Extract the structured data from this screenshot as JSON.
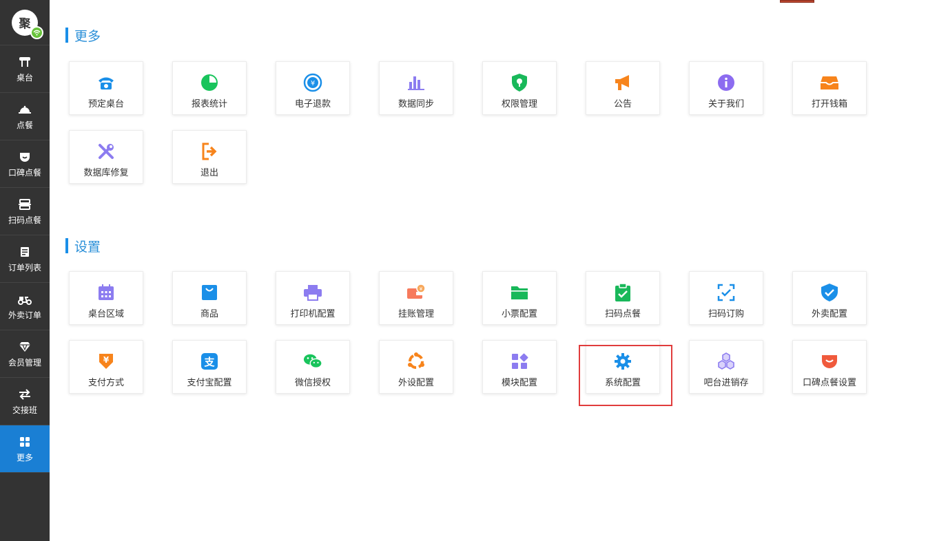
{
  "sidebar": {
    "logo_text": "聚",
    "items": [
      {
        "label": "桌台",
        "icon": "table-icon"
      },
      {
        "label": "点餐",
        "icon": "cloche-icon"
      },
      {
        "label": "口碑点餐",
        "icon": "koubei-icon"
      },
      {
        "label": "扫码点餐",
        "icon": "scan-icon"
      },
      {
        "label": "订单列表",
        "icon": "order-list-icon"
      },
      {
        "label": "外卖订单",
        "icon": "delivery-icon"
      },
      {
        "label": "会员管理",
        "icon": "diamond-icon"
      },
      {
        "label": "交接班",
        "icon": "swap-icon"
      },
      {
        "label": "更多",
        "icon": "grid-icon",
        "active": true
      }
    ]
  },
  "sections": {
    "more": {
      "title": "更多",
      "tiles": [
        {
          "label": "预定桌台",
          "icon": "phone-icon",
          "color": "#1a8fe8"
        },
        {
          "label": "报表统计",
          "icon": "pie-chart-icon",
          "color": "#19c45c"
        },
        {
          "label": "电子退款",
          "icon": "refund-icon",
          "color": "#1a8fe8"
        },
        {
          "label": "数据同步",
          "icon": "bar-chart-icon",
          "color": "#8c7cf0"
        },
        {
          "label": "权限管理",
          "icon": "shield-icon",
          "color": "#19b85a"
        },
        {
          "label": "公告",
          "icon": "megaphone-icon",
          "color": "#f7841c"
        },
        {
          "label": "关于我们",
          "icon": "info-icon",
          "color": "#8c6cf0"
        },
        {
          "label": "打开钱箱",
          "icon": "cashbox-icon",
          "color": "#f7841c"
        },
        {
          "label": "数据库修复",
          "icon": "tools-icon",
          "color": "#8c7cf0"
        },
        {
          "label": "退出",
          "icon": "exit-icon",
          "color": "#f7841c"
        }
      ]
    },
    "settings": {
      "title": "设置",
      "tiles": [
        {
          "label": "桌台区域",
          "icon": "calendar-icon",
          "color": "#8c7cf0"
        },
        {
          "label": "商品",
          "icon": "shopping-bag-icon",
          "color": "#1a8fe8"
        },
        {
          "label": "打印机配置",
          "icon": "printer-icon",
          "color": "#8c7cf0"
        },
        {
          "label": "挂账管理",
          "icon": "wallet-icon",
          "color": "#f77a5c"
        },
        {
          "label": "小票配置",
          "icon": "folder-icon",
          "color": "#19b85a"
        },
        {
          "label": "扫码点餐",
          "icon": "clipboard-check-icon",
          "color": "#19b85a"
        },
        {
          "label": "扫码订购",
          "icon": "scan-check-icon",
          "color": "#1a8fe8"
        },
        {
          "label": "外卖配置",
          "icon": "badge-check-icon",
          "color": "#1a8fe8"
        },
        {
          "label": "支付方式",
          "icon": "yen-icon",
          "color": "#f7841c"
        },
        {
          "label": "支付宝配置",
          "icon": "alipay-icon",
          "color": "#1a8fe8"
        },
        {
          "label": "微信授权",
          "icon": "wechat-icon",
          "color": "#19c45c"
        },
        {
          "label": "外设配置",
          "icon": "peripheral-icon",
          "color": "#f7841c"
        },
        {
          "label": "模块配置",
          "icon": "modules-icon",
          "color": "#8c7cf0"
        },
        {
          "label": "系统配置",
          "icon": "gear-icon",
          "color": "#1a8fe8"
        },
        {
          "label": "吧台进销存",
          "icon": "cubes-icon",
          "color": "#8c7cf0"
        },
        {
          "label": "口碑点餐设置",
          "icon": "koubei-settings-icon",
          "color": "#f05a3c"
        }
      ]
    }
  }
}
